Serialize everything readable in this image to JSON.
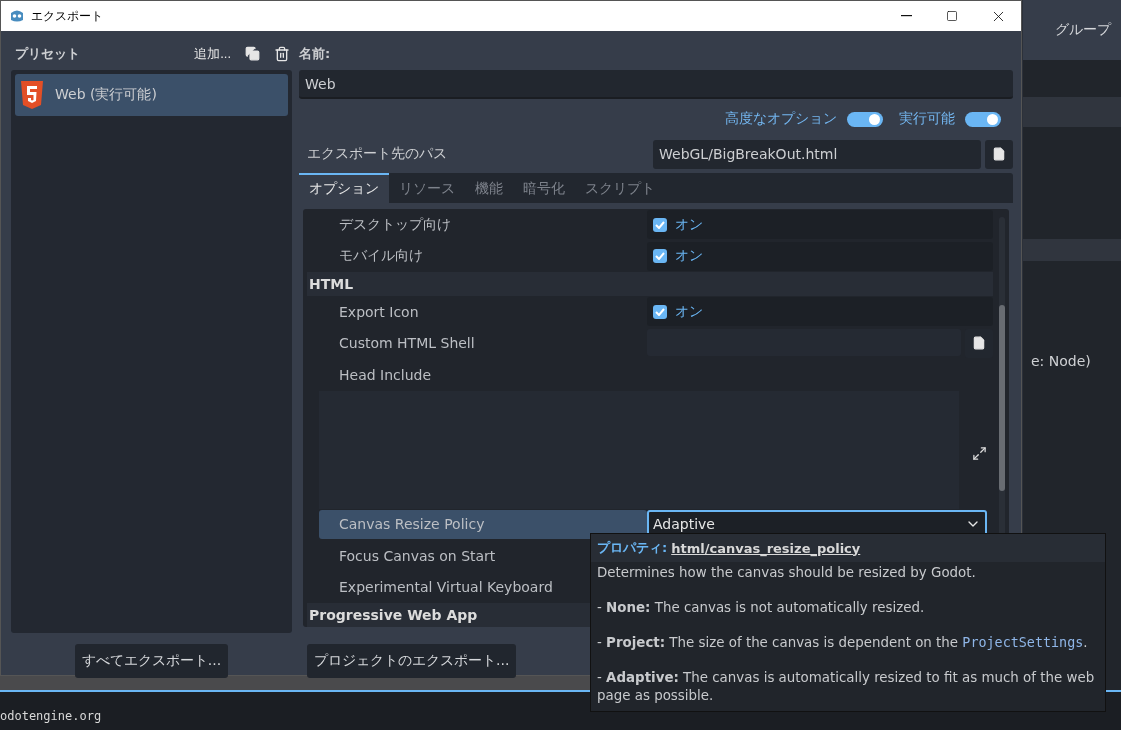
{
  "window": {
    "title": "エクスポート"
  },
  "presets": {
    "title": "プリセット",
    "add_label": "追加...",
    "items": [
      {
        "label": "Web (実行可能)",
        "selected": true
      }
    ]
  },
  "name": {
    "label": "名前:",
    "value": "Web"
  },
  "toggles": [
    {
      "label": "高度なオプション",
      "on": true
    },
    {
      "label": "実行可能",
      "on": true
    }
  ],
  "export_path": {
    "label": "エクスポート先のパス",
    "value": "WebGL/BigBreakOut.html"
  },
  "tabs": [
    {
      "label": "オプション",
      "selected": true
    },
    {
      "label": "リソース",
      "selected": false
    },
    {
      "label": "機能",
      "selected": false
    },
    {
      "label": "暗号化",
      "selected": false
    },
    {
      "label": "スクリプト",
      "selected": false
    }
  ],
  "properties": [
    {
      "kind": "check",
      "label": "デスクトップ向け",
      "checked": true,
      "value": "オン"
    },
    {
      "kind": "check",
      "label": "モバイル向け",
      "checked": true,
      "value": "オン"
    },
    {
      "kind": "section",
      "label": "HTML"
    },
    {
      "kind": "check",
      "label": "Export Icon",
      "checked": true,
      "value": "オン"
    },
    {
      "kind": "file",
      "label": "Custom HTML Shell"
    },
    {
      "kind": "textarea",
      "label": "Head Include"
    },
    {
      "kind": "select",
      "label": "Canvas Resize Policy",
      "value": "Adaptive",
      "selected": true
    },
    {
      "kind": "plain",
      "label": "Focus Canvas on Start"
    },
    {
      "kind": "plain",
      "label": "Experimental Virtual Keyboard"
    },
    {
      "kind": "section",
      "label": "Progressive Web App"
    }
  ],
  "buttons": [
    "すべてエクスポート...",
    "プロジェクトのエクスポート..."
  ],
  "background": {
    "group_label": "グループ",
    "node_text": "e: Node)",
    "console_line": "odotengine.org"
  },
  "tooltip": {
    "prefix": "プロパティ:",
    "property": "html/canvas_resize_policy",
    "paragraphs": [
      {
        "parts": [
          {
            "kind": "text",
            "text": "Determines how the canvas should be resized by Godot."
          }
        ]
      },
      {
        "parts": [
          {
            "kind": "text",
            "text": "- **None:** The canvas is not automatically resized."
          }
        ]
      },
      {
        "parts": [
          {
            "kind": "text",
            "text": "- **Project:** The size of the canvas is dependent on the "
          },
          {
            "kind": "code",
            "text": "ProjectSettings"
          },
          {
            "kind": "text",
            "text": "."
          }
        ]
      },
      {
        "parts": [
          {
            "kind": "text",
            "text": "- **Adaptive:** The canvas is automatically resized to fit as much of the web page as possible."
          }
        ]
      }
    ]
  }
}
